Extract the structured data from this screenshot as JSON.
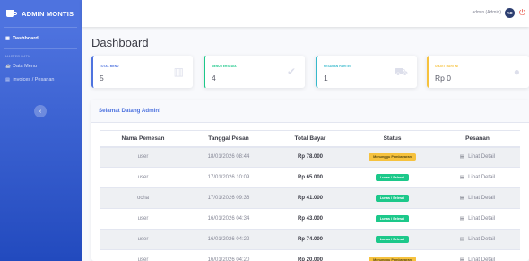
{
  "brand": {
    "name": "ADMIN MONTIS"
  },
  "sidebar": {
    "dashboard": "Dashboard",
    "heading": "MASTER DATA",
    "items": [
      {
        "label": "Data Menu"
      },
      {
        "label": "Invoices / Pesanan"
      }
    ],
    "toggle_glyph": "‹"
  },
  "topbar": {
    "user_name": "admin (Admin)",
    "avatar_initials": "AD"
  },
  "page_title": "Dashboard",
  "cards": [
    {
      "label": "TOTAL MENU",
      "value": "5",
      "icon": "book-icon"
    },
    {
      "label": "MENU TERSEDIA",
      "value": "4",
      "icon": "check-circle-icon"
    },
    {
      "label": "PESANAN HARI INI",
      "value": "1",
      "icon": "cart-icon"
    },
    {
      "label": "OMZET HARI INI",
      "value": "Rp 0",
      "icon": "dollar-icon"
    }
  ],
  "welcome": "Selamat Datang Admin!",
  "table": {
    "headers": [
      "Nama Pemesan",
      "Tanggal Pesan",
      "Total Bayar",
      "Status",
      "Pesanan"
    ],
    "rows": [
      {
        "name": "user",
        "date": "18/01/2026 08:44",
        "total": "Rp 78.000",
        "status": "Menunggu Pembayaran",
        "status_type": "wait",
        "action": "Lihat Detail"
      },
      {
        "name": "user",
        "date": "17/01/2026 10:09",
        "total": "Rp 65.000",
        "status": "Lunas / Selesai",
        "status_type": "paid",
        "action": "Lihat Detail"
      },
      {
        "name": "ocha",
        "date": "17/01/2026 09:36",
        "total": "Rp 41.000",
        "status": "Lunas / Selesai",
        "status_type": "paid",
        "action": "Lihat Detail"
      },
      {
        "name": "user",
        "date": "16/01/2026 04:34",
        "total": "Rp 43.000",
        "status": "Lunas / Selesai",
        "status_type": "paid",
        "action": "Lihat Detail"
      },
      {
        "name": "user",
        "date": "16/01/2026 04:22",
        "total": "Rp 74.000",
        "status": "Lunas / Selesai",
        "status_type": "paid",
        "action": "Lihat Detail"
      },
      {
        "name": "user",
        "date": "16/01/2026 04:20",
        "total": "Rp 20.000",
        "status": "Menunggu Pembayaran",
        "status_type": "wait",
        "action": "Lihat Detail"
      }
    ]
  },
  "colors": {
    "primary": "#4e73df",
    "success": "#1cc88a",
    "info": "#36b9cc",
    "warning": "#f6c23e",
    "danger": "#e74a3b"
  }
}
